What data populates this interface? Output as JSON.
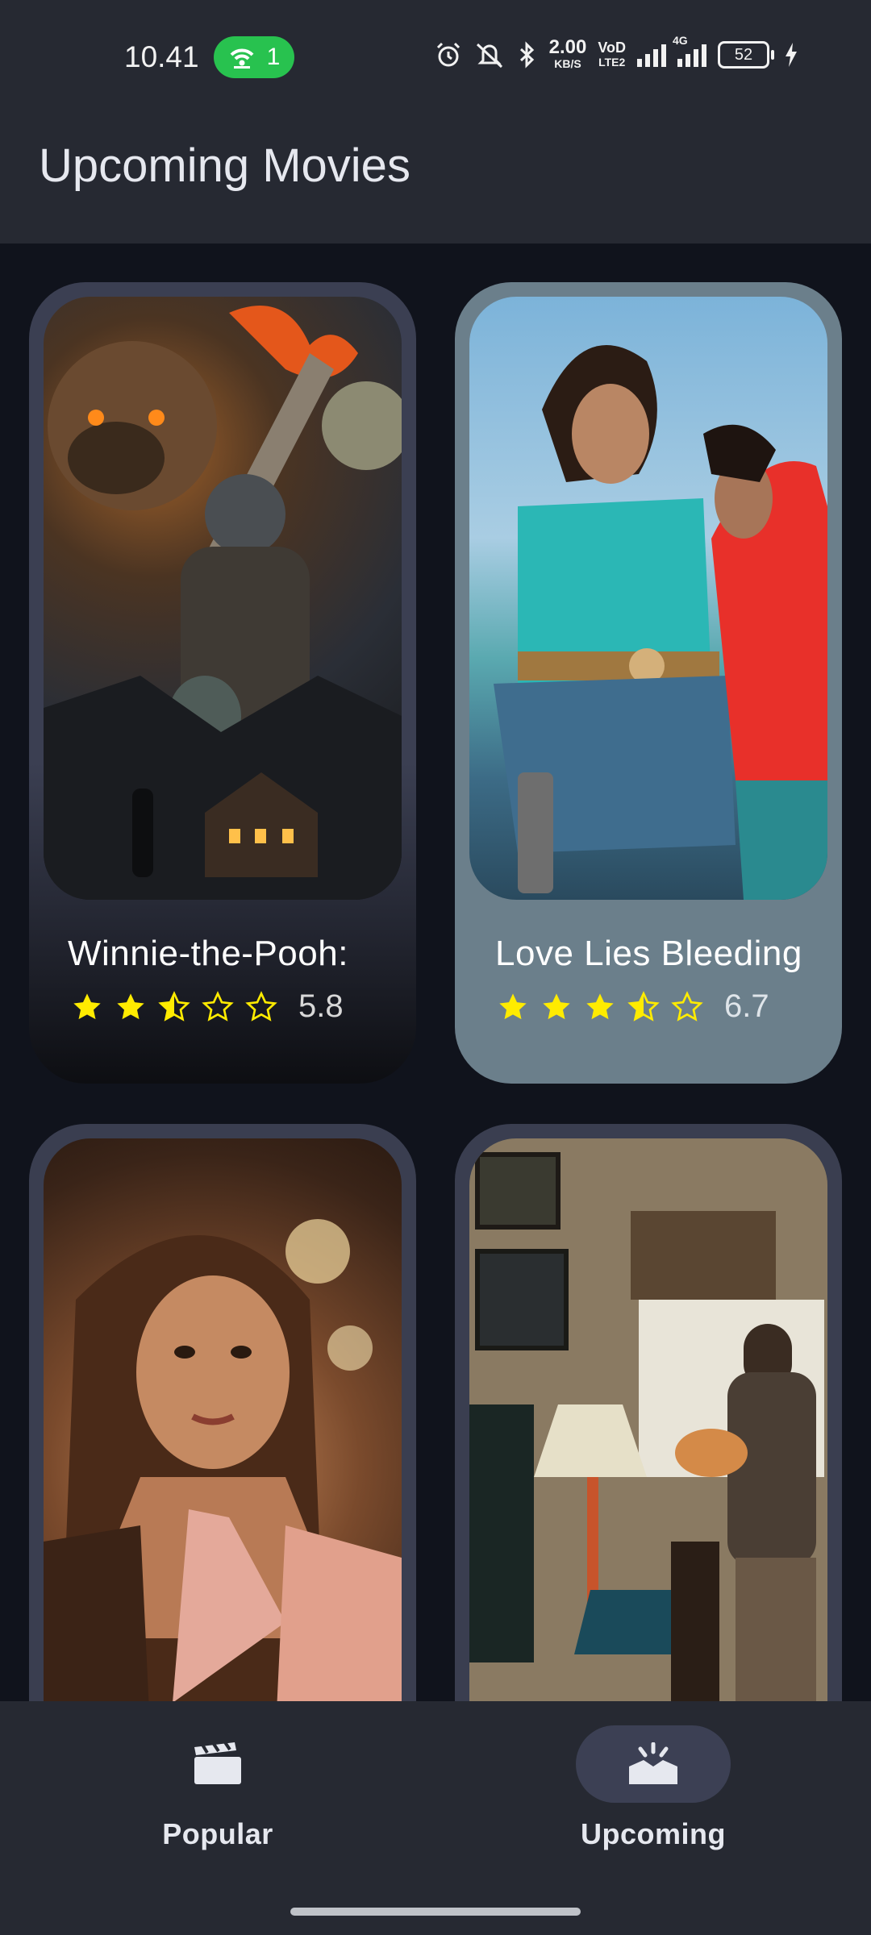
{
  "status_bar": {
    "time": "10.41",
    "hotspot_count": "1",
    "net_speed_value": "2.00",
    "net_speed_unit": "KB/S",
    "volte_top": "VoD",
    "volte_bottom": "LTE2",
    "net_type": "4G",
    "battery": "52"
  },
  "app_bar": {
    "title": "Upcoming Movies"
  },
  "movies": [
    {
      "title": "Winnie-the-Pooh:",
      "rating": "5.8",
      "stars": [
        "full",
        "full",
        "half",
        "empty",
        "empty"
      ]
    },
    {
      "title": "Love Lies Bleeding",
      "rating": "6.7",
      "stars": [
        "full",
        "full",
        "full",
        "half",
        "empty"
      ]
    },
    {
      "title": "",
      "rating": "",
      "stars": []
    },
    {
      "title": "",
      "rating": "",
      "stars": []
    }
  ],
  "bottom_nav": {
    "items": [
      {
        "label": "Popular",
        "icon": "clapperboard-icon",
        "selected": false
      },
      {
        "label": "Upcoming",
        "icon": "new-releases-icon",
        "selected": true
      }
    ]
  },
  "colors": {
    "star": "#ffeb00",
    "selected_pill": "#3c4054",
    "card_highlight": "#6b7f8b"
  }
}
